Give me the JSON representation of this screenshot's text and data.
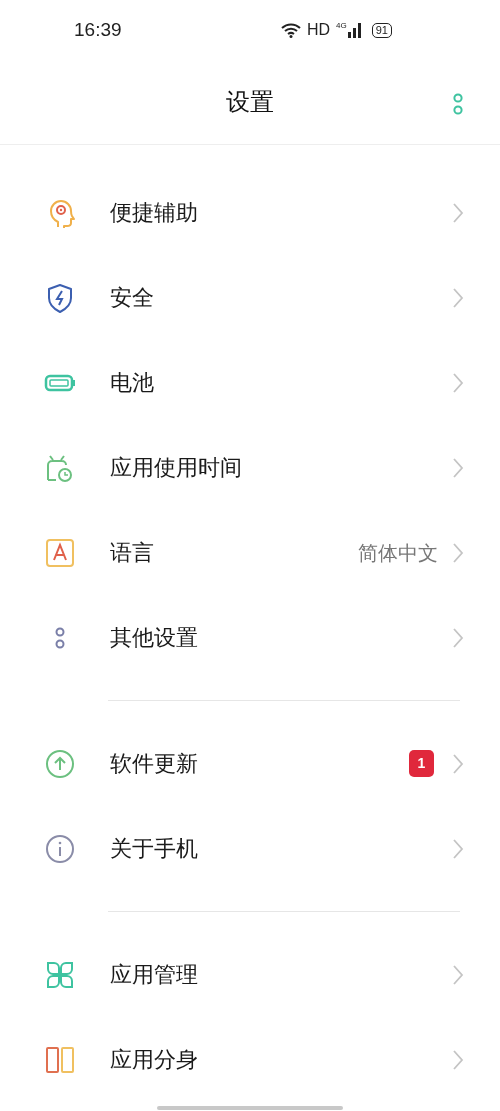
{
  "status_bar": {
    "time": "16:39",
    "hd": "HD",
    "network": "4G",
    "battery": "91"
  },
  "header": {
    "title": "设置"
  },
  "groups": [
    {
      "items": [
        {
          "label": "便捷辅助"
        },
        {
          "label": "安全"
        },
        {
          "label": "电池"
        },
        {
          "label": "应用使用时间"
        },
        {
          "label": "语言",
          "value": "简体中文"
        },
        {
          "label": "其他设置"
        }
      ]
    },
    {
      "items": [
        {
          "label": "软件更新",
          "badge": "1"
        },
        {
          "label": "关于手机"
        }
      ]
    },
    {
      "items": [
        {
          "label": "应用管理"
        },
        {
          "label": "应用分身"
        }
      ]
    }
  ]
}
